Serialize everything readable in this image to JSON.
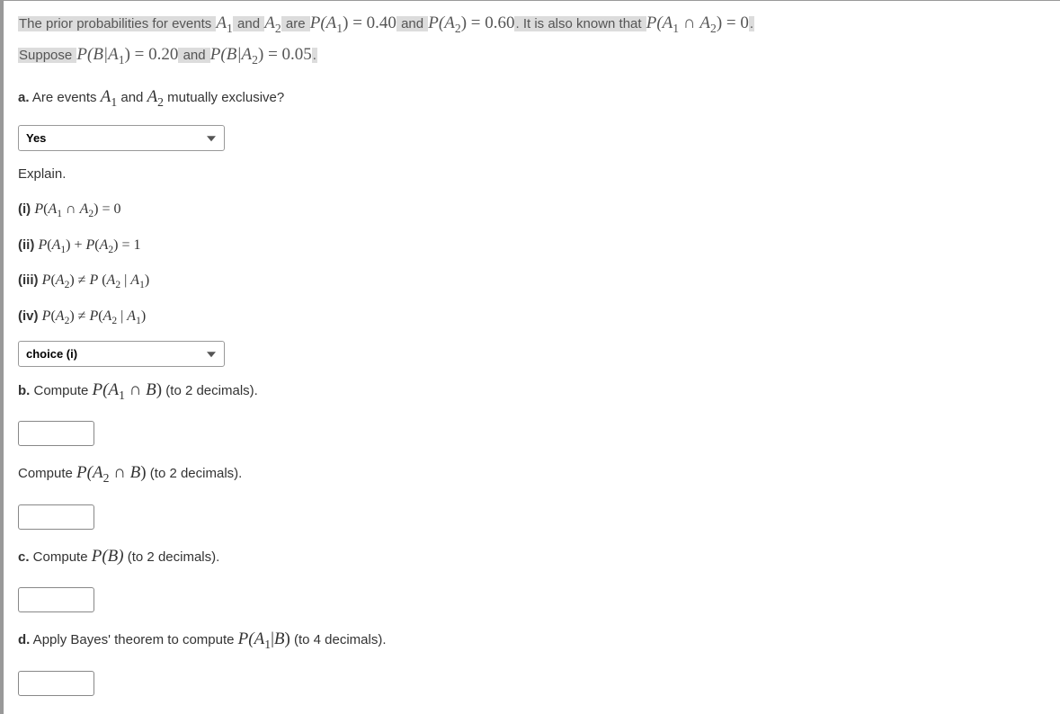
{
  "intro": {
    "t1": "The prior probabilities for events ",
    "A1": "A",
    "sub1": "1",
    "t2": " and ",
    "A2": "A",
    "sub2": "2",
    "t3": " are ",
    "eq1_lhs": "P(A",
    "eq1_sub": "1",
    "eq1_rhs": ") = 0.40",
    "t4": " and ",
    "eq2_lhs": "P(A",
    "eq2_sub": "2",
    "eq2_rhs": ") = 0.60",
    "t5": ". It is also known that ",
    "eq3_lhs": "P(A",
    "eq3_sub1": "1",
    "eq3_cap": " ∩ ",
    "eq3_A2": "A",
    "eq3_sub2": "2",
    "eq3_rhs": ") = 0",
    "t6": ".",
    "t7": "Suppose ",
    "eq4_lhs": "P(B|A",
    "eq4_sub": "1",
    "eq4_rhs": ") = 0.20",
    "t8": " and ",
    "eq5_lhs": "P(B|A",
    "eq5_sub": "2",
    "eq5_rhs": ") = 0.05",
    "t9": "."
  },
  "parts": {
    "a_label": "a.",
    "a_text_1": " Are events ",
    "a_A1": "A",
    "a_sub1": "1",
    "a_text_2": " and ",
    "a_A2": "A",
    "a_sub2": "2",
    "a_text_3": " mutually exclusive?",
    "select_a_value": "Yes",
    "explain": "Explain.",
    "options": {
      "i_label": "(i)",
      "i_math": " P(A₁ ∩ A₂) = 0",
      "ii_label": "(ii)",
      "ii_math": " P(A₁) + P(A₂) = 1",
      "iii_label": "(iii)",
      "iii_math": " P(A₂) ≠ P (A₂ | A₁)",
      "iv_label": "(iv)",
      "iv_math": " P(A₂) ≠ P(A₂ | A₁)"
    },
    "select_explain_value": "choice (i)",
    "b_label": "b.",
    "b_text_1": " Compute ",
    "b_math_lhs": "P(A",
    "b_sub": "1",
    "b_cap": " ∩ ",
    "b_B": "B",
    "b_rhs": ")",
    "b_text_2": " (to 2 decimals).",
    "b2_text_1": "Compute ",
    "b2_math_lhs": "P(A",
    "b2_sub": "2",
    "b2_cap": " ∩ ",
    "b2_B": "B",
    "b2_rhs": ")",
    "b2_text_2": " (to 2 decimals).",
    "c_label": "c.",
    "c_text_1": " Compute ",
    "c_math_lhs": "P(B)",
    "c_text_2": " (to 2 decimals).",
    "d_label": "d.",
    "d_text_1": " Apply Bayes' theorem to compute ",
    "d_math_lhs": "P(A",
    "d_sub": "1",
    "d_bar": "|",
    "d_B": "B",
    "d_rhs": ")",
    "d_text_2": " (to 4 decimals)."
  }
}
